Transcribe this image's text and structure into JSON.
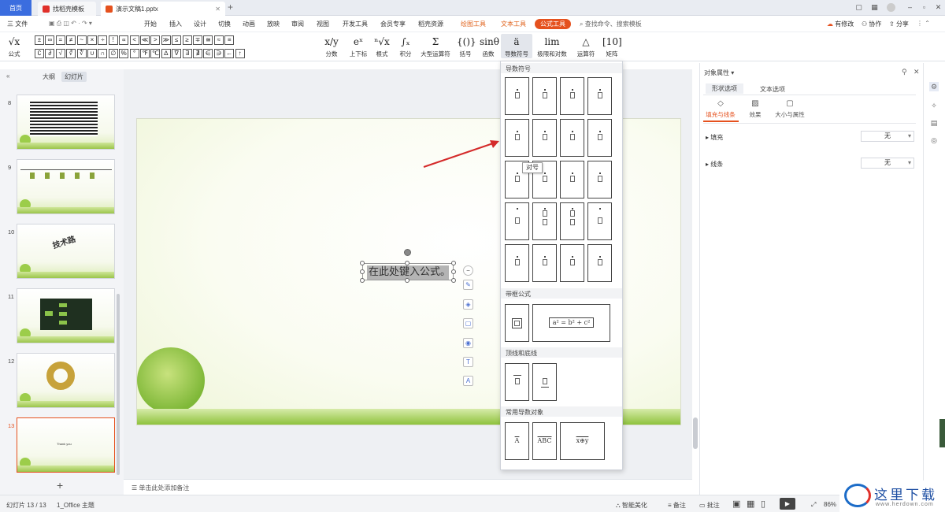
{
  "titlebar": {
    "tabs": [
      {
        "label": "首页"
      },
      {
        "label": "找稻壳模板"
      },
      {
        "label": "演示文稿1.pptx"
      }
    ],
    "add": "+"
  },
  "menubar": {
    "file": "三 文件",
    "items": [
      "开始",
      "插入",
      "设计",
      "切换",
      "动画",
      "放映",
      "审阅",
      "视图",
      "开发工具",
      "会员专享",
      "稻壳资源",
      "绘图工具",
      "文本工具",
      "公式工具"
    ],
    "search": "查找命令、搜索模板",
    "right": [
      "有修改",
      "协作",
      "分享"
    ]
  },
  "ribbon": {
    "formula_label": "公式",
    "row1": [
      "±",
      "∞",
      "=",
      "≠",
      "~",
      "×",
      "÷",
      "!",
      "∝",
      "<",
      "≪",
      ">",
      "≫",
      "≤",
      "≥",
      "∓",
      "≅",
      "≈",
      "≡"
    ],
    "row2": [
      "∁",
      "∂",
      "√",
      "∛",
      "∜",
      "∪",
      "∩",
      "∅",
      "%",
      "°",
      "℉",
      "℃",
      "∆",
      "∇",
      "∃",
      "∄",
      "∈",
      "∋",
      "←",
      "↑"
    ],
    "groups": [
      {
        "glyph": "x/y",
        "label": "分数"
      },
      {
        "glyph": "eˣ",
        "label": "上下标"
      },
      {
        "glyph": "ⁿ√x",
        "label": "根式"
      },
      {
        "glyph": "∫ₓ",
        "label": "积分"
      },
      {
        "glyph": "Σ",
        "label": "大型运算符"
      },
      {
        "glyph": "{()}",
        "label": "括号"
      },
      {
        "glyph": "sinθ",
        "label": "函数"
      },
      {
        "glyph": "ä",
        "label": "导数符号"
      },
      {
        "glyph": "lim",
        "label": "极限和对数"
      },
      {
        "glyph": "△",
        "label": "运算符"
      },
      {
        "glyph": "[10]",
        "label": "矩阵"
      }
    ],
    "lim_sub": "n→∞"
  },
  "leftpane": {
    "tabs": [
      "大纲",
      "幻灯片"
    ],
    "slides": [
      {
        "num": "8"
      },
      {
        "num": "9"
      },
      {
        "num": "10",
        "text": "技术路"
      },
      {
        "num": "11"
      },
      {
        "num": "12"
      },
      {
        "num": "13",
        "text": "Thank you"
      }
    ],
    "add": "+"
  },
  "slide": {
    "placeholder": "在此处键入公式。"
  },
  "notes": {
    "hint": "单击此处添加备注"
  },
  "dropdown": {
    "sections": [
      "导数符号",
      "带框公式",
      "顶线和底线",
      "常用导数对象"
    ],
    "boxed_formula": "a² = b² + c²",
    "common": [
      "A",
      "ABC",
      "x⊕y"
    ],
    "tooltip": "对号"
  },
  "rightpane": {
    "title": "对象属性 ▾",
    "tabs": [
      "形状选项",
      "文本选项"
    ],
    "subtabs": [
      "填充与线条",
      "效果",
      "大小与属性"
    ],
    "props": [
      {
        "label": "填充",
        "value": "无"
      },
      {
        "label": "线条",
        "value": "无"
      }
    ]
  },
  "statusbar": {
    "slide_info": "幻灯片 13 / 13",
    "theme": "1_Office 主题",
    "beautify": "智能美化",
    "notes": "备注",
    "comments": "批注",
    "zoom": "86%"
  },
  "watermark": {
    "cn": "这里下载",
    "url": "www.herdown.com"
  }
}
